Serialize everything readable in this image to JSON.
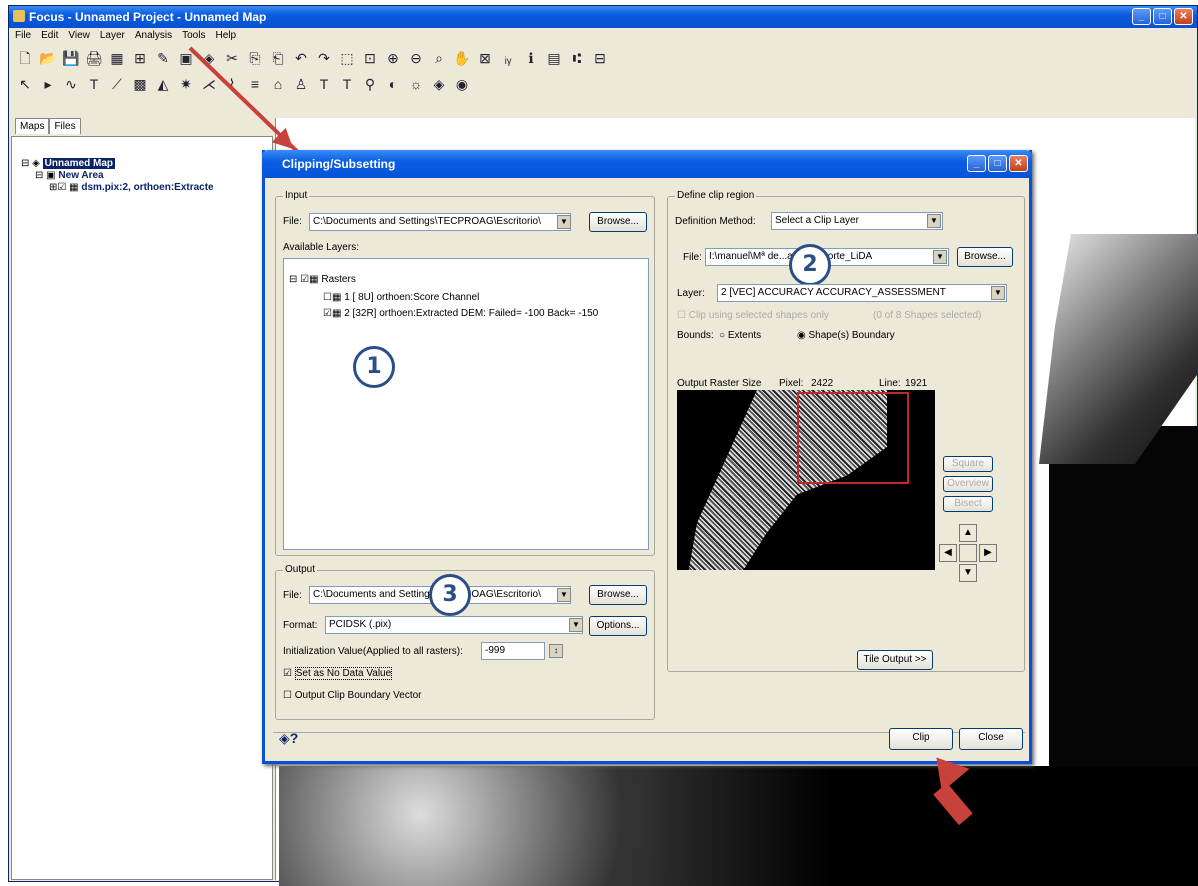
{
  "app": {
    "title": "Focus - Unnamed Project - Unnamed Map",
    "menu": [
      "File",
      "Edit",
      "View",
      "Layer",
      "Analysis",
      "Tools",
      "Help"
    ],
    "toolbar1": [
      "🗋",
      "📂",
      "💾",
      "🖨",
      "▦",
      "⊞",
      "✎",
      "▣",
      "◈",
      "✂",
      "⎘",
      "⎗",
      "↶",
      "↷",
      "⬚",
      "⊡",
      "⊕",
      "⊖",
      "⌕",
      "✋",
      "⊠",
      "ᵢᵧ",
      "ℹ",
      "▤",
      "⑆",
      "⊟"
    ],
    "toolbar2": [
      "↖",
      "▸",
      "∿",
      "T",
      "⟋",
      "▩",
      "◭",
      "✷",
      "⋌",
      "⌇",
      "≡",
      "⌂",
      "♙",
      "T",
      "T",
      "⚲",
      "◐",
      "☼",
      "◈",
      "◉"
    ],
    "tabs": [
      "Maps",
      "Files"
    ],
    "tree": {
      "root": "Unnamed Map",
      "area": "New Area",
      "layer": "dsm.pix:2, orthoen:Extracte"
    }
  },
  "dialog": {
    "title": "Clipping/Subsetting",
    "input": {
      "group": "Input",
      "file_label": "File:",
      "file_value": "C:\\Documents and Settings\\TECPROAG\\Escritorio\\",
      "browse": "Browse...",
      "available_layers": "Available Layers:",
      "rasters_label": "Rasters",
      "layer1": "1 [ 8U] orthoen:Score Channel",
      "layer2": "2 [32R] orthoen:Extracted DEM: Failed= -100 Back= -150"
    },
    "output": {
      "group": "Output",
      "file_label": "File:",
      "file_value": "C:\\Documents and Settings\\TECPROAG\\Escritorio\\",
      "browse": "Browse...",
      "format_label": "Format:",
      "format_value": "PCIDSK (.pix)",
      "options": "Options...",
      "init_label": "Initialization Value(Applied to all rasters):",
      "init_value": "-999",
      "set_nodata": "Set as No Data Value",
      "output_clip": "Output Clip Boundary Vector"
    },
    "clip": {
      "group": "Define clip region",
      "method_label": "Definition Method:",
      "method_value": "Select a Clip Layer",
      "file_label": "File:",
      "file_value": "I:\\manuel\\Mª de...as_y_recorte_LiDA",
      "browse": "Browse...",
      "layer_label": "Layer:",
      "layer_value": "2 [VEC] ACCURACY ACCURACY_ASSESSMENT",
      "clip_selected": "Clip using selected shapes only",
      "shapes_selected": "(0 of 8 Shapes selected)",
      "bounds_label": "Bounds:",
      "extents": "Extents",
      "shape_boundary": "Shape(s) Boundary",
      "raster_size_label": "Output Raster Size",
      "pixel_label": "Pixel:",
      "pixel_value": "2422",
      "line_label": "Line:",
      "line_value": "1921",
      "square": "Square",
      "overview": "Overview",
      "bisect": "Bisect",
      "tile_output": "Tile Output >>"
    },
    "footer": {
      "clip": "Clip",
      "close": "Close",
      "help": "?"
    },
    "markers": [
      "1",
      "2",
      "3"
    ]
  },
  "colors": {
    "accent": "#0a5ce0",
    "arrow": "#c9413b",
    "marker": "#2a4e86",
    "selection_rect": "#c0282c"
  }
}
